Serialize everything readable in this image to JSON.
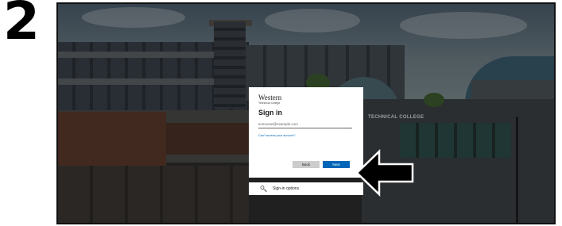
{
  "step": {
    "number": "2"
  },
  "background": {
    "sign_text": "TECHNICAL COLLEGE"
  },
  "dialog": {
    "brand_name": "Western",
    "brand_subtitle": "Technical College",
    "heading": "Sign in",
    "email_placeholder": "someone@example.com",
    "cant_access_link": "Can't access your account?",
    "back_label": "Back",
    "next_label": "Next"
  },
  "signin_options": {
    "label": "Sign-in options",
    "icon": "key-icon"
  },
  "colors": {
    "accent": "#0067b8",
    "back_button": "#cccccc",
    "arrow": "#000000"
  },
  "annotation": {
    "pointer": "arrow pointing at Next button"
  }
}
